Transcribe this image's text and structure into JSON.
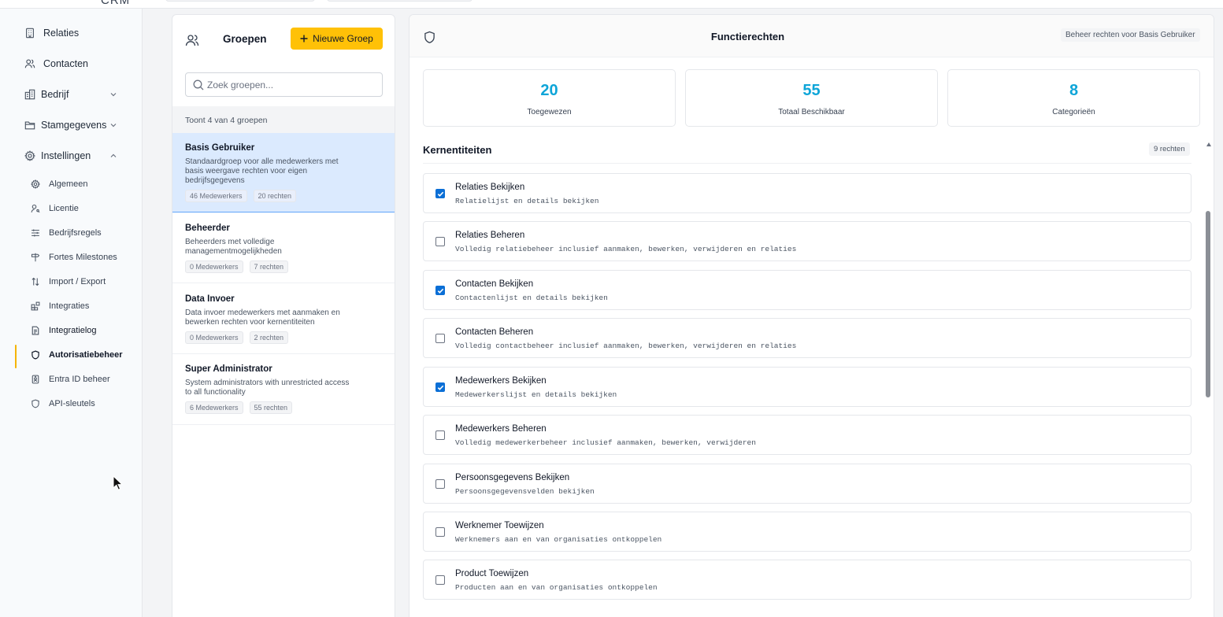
{
  "app": {
    "brand": "CRM"
  },
  "sidebar": {
    "items": [
      {
        "label": "Relaties",
        "icon": "building-icon"
      },
      {
        "label": "Contacten",
        "icon": "users-icon"
      },
      {
        "label": "Bedrijf",
        "icon": "office-icon",
        "expandable": true
      },
      {
        "label": "Stamgegevens",
        "icon": "folder-icon",
        "expandable": true
      },
      {
        "label": "Instellingen",
        "icon": "gear-icon",
        "expanded": true
      }
    ],
    "sub_items": [
      {
        "label": "Algemeen",
        "icon": "gear-icon"
      },
      {
        "label": "Licentie",
        "icon": "user-key-icon"
      },
      {
        "label": "Bedrijfsregels",
        "icon": "sliders-icon"
      },
      {
        "label": "Fortes Milestones",
        "icon": "signpost-icon"
      },
      {
        "label": "Import / Export",
        "icon": "arrows-updown-icon"
      },
      {
        "label": "Integraties",
        "icon": "blocks-icon"
      },
      {
        "label": "Integratielog",
        "icon": "document-icon"
      },
      {
        "label": "Autorisatiebeheer",
        "icon": "shield-icon",
        "active": true
      },
      {
        "label": "Entra ID beheer",
        "icon": "id-badge-icon"
      },
      {
        "label": "API-sleutels",
        "icon": "shield-icon"
      }
    ]
  },
  "groups_panel": {
    "title": "Groepen",
    "new_button": "Nieuwe Groep",
    "search_placeholder": "Zoek groepen...",
    "count_text": "Toont 4 van 4 groepen",
    "groups": [
      {
        "name": "Basis Gebruiker",
        "description": "Standaardgroep voor alle medewerkers met basis weergave rechten voor eigen bedrijfsgegevens",
        "members": "46 Medewerkers",
        "rights": "20 rechten",
        "selected": true
      },
      {
        "name": "Beheerder",
        "description": "Beheerders met volledige managementmogelijkheden",
        "members": "0 Medewerkers",
        "rights": "7 rechten"
      },
      {
        "name": "Data Invoer",
        "description": "Data invoer medewerkers met aanmaken en bewerken rechten voor kernentiteiten",
        "members": "0 Medewerkers",
        "rights": "2 rechten"
      },
      {
        "name": "Super Administrator",
        "description": "System administrators with unrestricted access to all functionality",
        "members": "6 Medewerkers",
        "rights": "55 rechten"
      }
    ]
  },
  "rights_panel": {
    "title": "Functierechten",
    "subtitle": "Beheer rechten voor Basis Gebruiker",
    "stats": [
      {
        "value": "20",
        "label": "Toegewezen"
      },
      {
        "value": "55",
        "label": "Totaal Beschikbaar"
      },
      {
        "value": "8",
        "label": "Categorieën"
      }
    ],
    "category": {
      "name": "Kernentiteiten",
      "badge": "9 rechten"
    },
    "permissions": [
      {
        "name": "Relaties Bekijken",
        "description": "Relatielijst en details bekijken",
        "checked": true
      },
      {
        "name": "Relaties Beheren",
        "description": "Volledig relatiebeheer inclusief aanmaken, bewerken, verwijderen en relaties",
        "checked": false
      },
      {
        "name": "Contacten Bekijken",
        "description": "Contactenlijst en details bekijken",
        "checked": true
      },
      {
        "name": "Contacten Beheren",
        "description": "Volledig contactbeheer inclusief aanmaken, bewerken, verwijderen en relaties",
        "checked": false
      },
      {
        "name": "Medewerkers Bekijken",
        "description": "Medewerkerslijst en details bekijken",
        "checked": true
      },
      {
        "name": "Medewerkers Beheren",
        "description": "Volledig medewerkerbeheer inclusief aanmaken, bewerken, verwijderen",
        "checked": false
      },
      {
        "name": "Persoonsgegevens Bekijken",
        "description": "Persoonsgegevensvelden bekijken",
        "checked": false
      },
      {
        "name": "Werknemer Toewijzen",
        "description": "Werknemers aan en van organisaties ontkoppelen",
        "checked": false
      },
      {
        "name": "Product Toewijzen",
        "description": "Producten aan en van organisaties ontkoppelen",
        "checked": false
      }
    ]
  },
  "colors": {
    "accent": "#ffc107",
    "stat_number": "#0ea5d8",
    "checkbox": "#0b6fd6",
    "selected_row": "#dbeafe"
  }
}
